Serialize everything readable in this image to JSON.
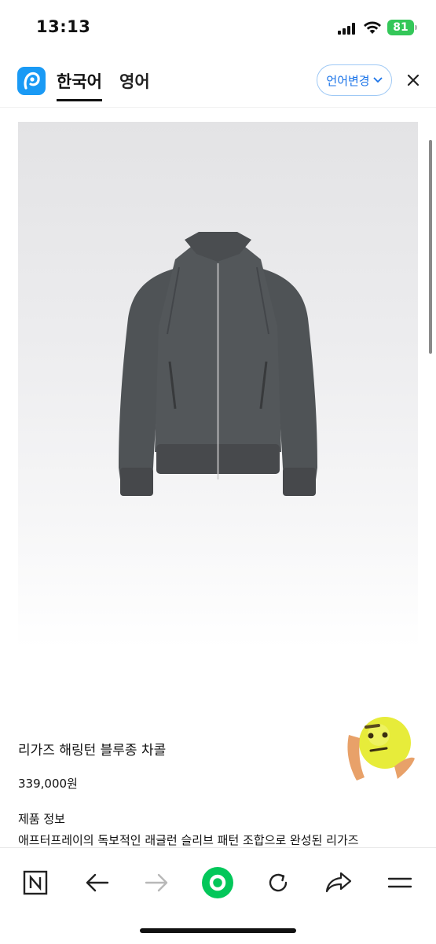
{
  "status_bar": {
    "time": "13:13",
    "battery": "81"
  },
  "header": {
    "tabs": [
      {
        "label": "한국어"
      },
      {
        "label": "영어"
      }
    ],
    "language_button": "언어변경"
  },
  "product": {
    "title": "리가즈 해링턴 블루종 차콜",
    "price": "339,000원",
    "info_heading": "제품 정보",
    "description": "애프터프레이의 독보적인 래글런 슬리브 패턴 조합으로 완성된 리가즈"
  },
  "colors": {
    "accent": "#1a9af5",
    "link": "#1a73e8",
    "refresh": "#03c75a",
    "jacket": "#4f5356"
  },
  "icons": [
    "naver-n-icon",
    "back-arrow-icon",
    "forward-arrow-icon",
    "green-dot-icon",
    "refresh-icon",
    "share-icon",
    "menu-icon",
    "close-icon",
    "chevron-down-icon",
    "papago-logo-icon"
  ]
}
